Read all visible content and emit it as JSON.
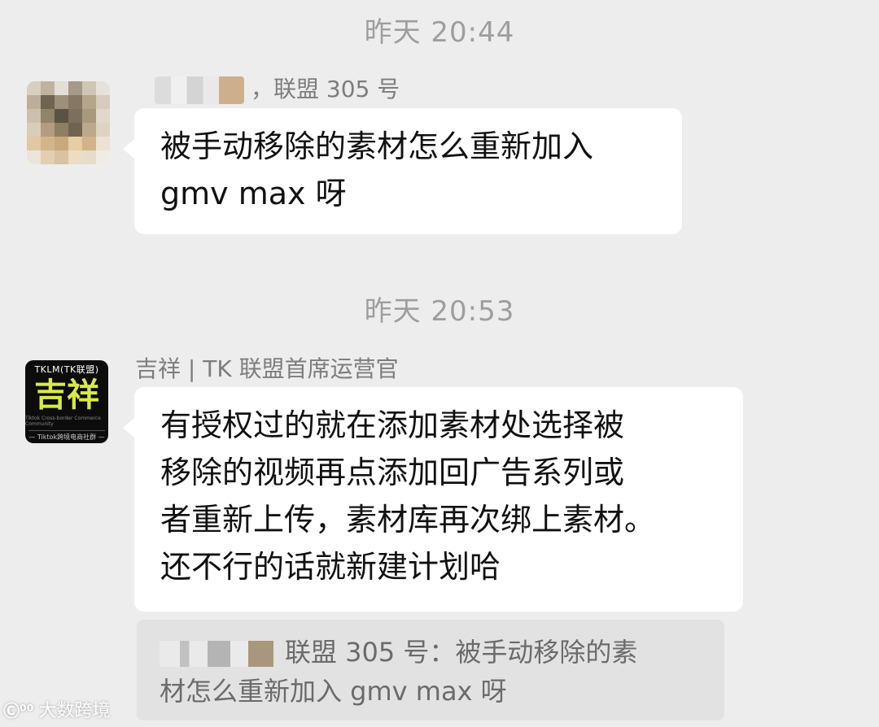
{
  "messages": [
    {
      "timestamp": "昨天 20:44",
      "sender_suffix": "，联盟 305 号",
      "lines": [
        "被手动移除的素材怎么重新加入",
        "gmv max 呀"
      ]
    },
    {
      "timestamp": "昨天 20:53",
      "sender": "吉祥 | TK 联盟首席运营官",
      "avatar": {
        "top": "TKLM(TK联盟)",
        "main": "吉祥",
        "sub": "Tiktok Cross-border Commerce Community",
        "bottom": "— Tiktok跨境电商社群 —"
      },
      "lines": [
        "有授权过的就在添加素材处选择被",
        "移除的视频再点添加回广告系列或",
        "者重新上传，素材库再次绑上素材。",
        "还不行的话就新建计划哈"
      ],
      "quote": {
        "lines": [
          "联盟 305 号：被手动移除的素",
          "材怎么重新加入 gmv max 呀"
        ]
      }
    }
  ],
  "watermark": {
    "mark": "Ⓒ⁰⁰",
    "text": "大数跨境"
  },
  "colors": {
    "background": "#ededed",
    "bubble": "#ffffff",
    "timestamp": "#9e9e9e",
    "logo_accent": "#d9e94a"
  }
}
